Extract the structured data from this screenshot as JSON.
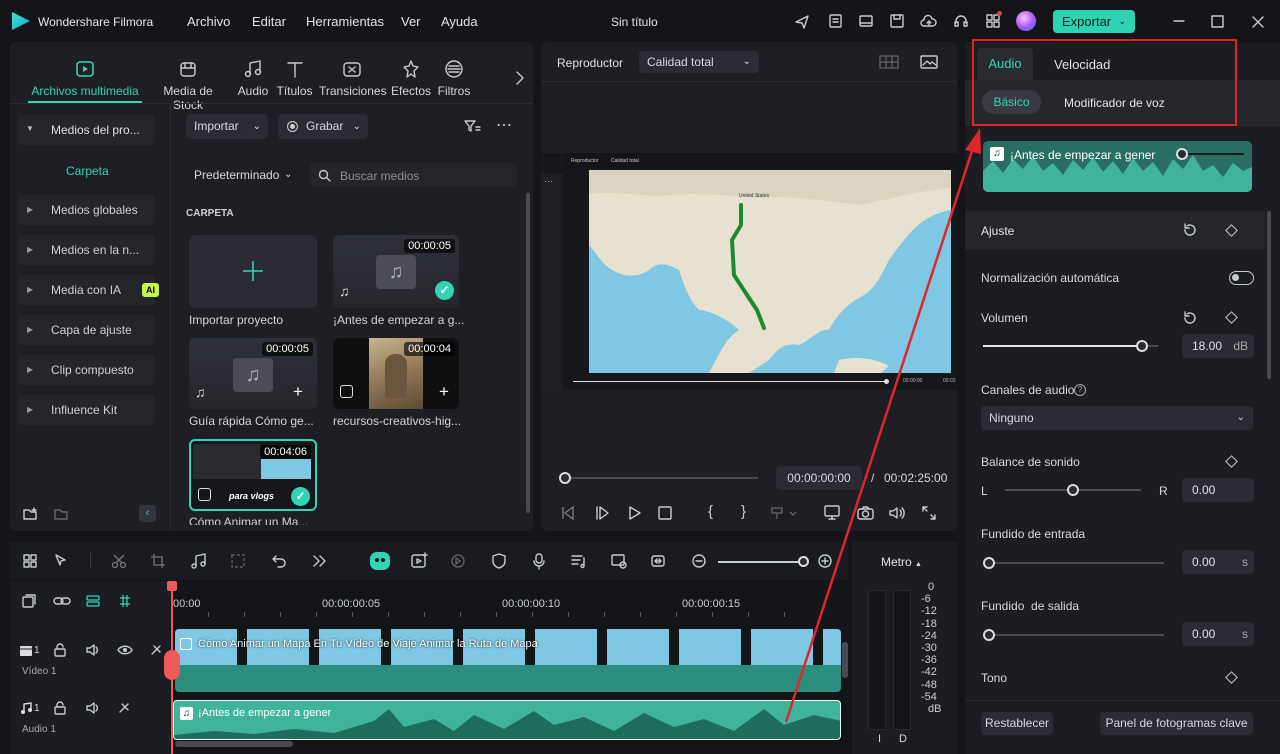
{
  "app": {
    "title": "Wondershare Filmora",
    "doc_title": "Sin título",
    "export_label": "Exportar"
  },
  "menu": [
    "Archivo",
    "Editar",
    "Herramientas",
    "Ver",
    "Ayuda"
  ],
  "nav": [
    "Archivos multimedia",
    "Media de Stock",
    "Audio",
    "Títulos",
    "Transiciones",
    "Efectos",
    "Filtros"
  ],
  "sidebar": {
    "project": "Medios del pro...",
    "folder": "Carpeta",
    "items": [
      "Medios globales",
      "Medios en la n...",
      "Media con IA",
      "Capa de ajuste",
      "Clip compuesto",
      "Influence Kit"
    ],
    "ai_badge": "AI"
  },
  "media": {
    "import": "Importar",
    "record": "Grabar",
    "sort": "Predeterminado",
    "search_placeholder": "Buscar medios",
    "section": "CARPETA",
    "items": [
      {
        "label": "Importar proyecto"
      },
      {
        "label": "¡Antes de empezar a g...",
        "duration": "00:00:05"
      },
      {
        "label": "Guía rápida Cómo ge...",
        "duration": "00:00:05"
      },
      {
        "label": "recursos-creativos-hig...",
        "duration": "00:00:04"
      },
      {
        "label": "Cómo Animar un Ma...",
        "duration": "00:04:06",
        "overlay": "para vlogs"
      }
    ]
  },
  "player": {
    "label": "Reproductor",
    "quality": "Calidad total",
    "map_label": "United States",
    "current": "00:00:00:00",
    "sep": "/",
    "total": "00:02:25:00",
    "mini_label": "Reproductor",
    "mini_quality": "Calidad total",
    "mini_time1": "00:00:00",
    "mini_time2": "00:02"
  },
  "right": {
    "tabs": [
      "Audio",
      "Velocidad"
    ],
    "subtabs": [
      "Básico",
      "Modificador de voz"
    ],
    "clip": "¡Antes de empezar a gener",
    "section": "Ajuste",
    "normalization": "Normalización automática",
    "volume": {
      "label": "Volumen",
      "value": "18.00",
      "unit": "dB",
      "level": 0.91
    },
    "channels": {
      "label": "Canales de audio",
      "value": "Ninguno"
    },
    "balance": {
      "label": "Balance de sonido",
      "left": "L",
      "right": "R",
      "value": "0.00",
      "level": 0.5
    },
    "fade_in": {
      "label": "Fundido de entrada",
      "value": "0.00",
      "unit": "s",
      "level": 0
    },
    "fade_out": {
      "label": "Fundido  de salida",
      "value": "0.00",
      "unit": "s",
      "level": 0
    },
    "tone": "Tono",
    "reset": "Restablecer",
    "keyframes": "Panel de fotogramas clave"
  },
  "timeline": {
    "ticks": [
      "00:00",
      "00:00:00:05",
      "00:00:00:10",
      "00:00:00:15"
    ],
    "video_track": "Vídeo 1",
    "video_num": "1",
    "audio_track": "Audio 1",
    "audio_num": "1",
    "video_clip": "Cómo Animar un Mapa En Tu Vídeo de Viaje  Animar la Ruta de Mapa",
    "audio_clip": "¡Antes de empezar a gener"
  },
  "meter": {
    "label": "Metro",
    "scale": [
      "0",
      "-6",
      "-12",
      "-18",
      "-24",
      "-30",
      "-36",
      "-42",
      "-48",
      "-54",
      "dB"
    ],
    "left": "I",
    "right": "D"
  },
  "colors": {
    "accent": "#2fd5b5",
    "annotation": "#e0262b",
    "audio_clip": "#3fb49a",
    "map_water": "#7fc7e3"
  }
}
